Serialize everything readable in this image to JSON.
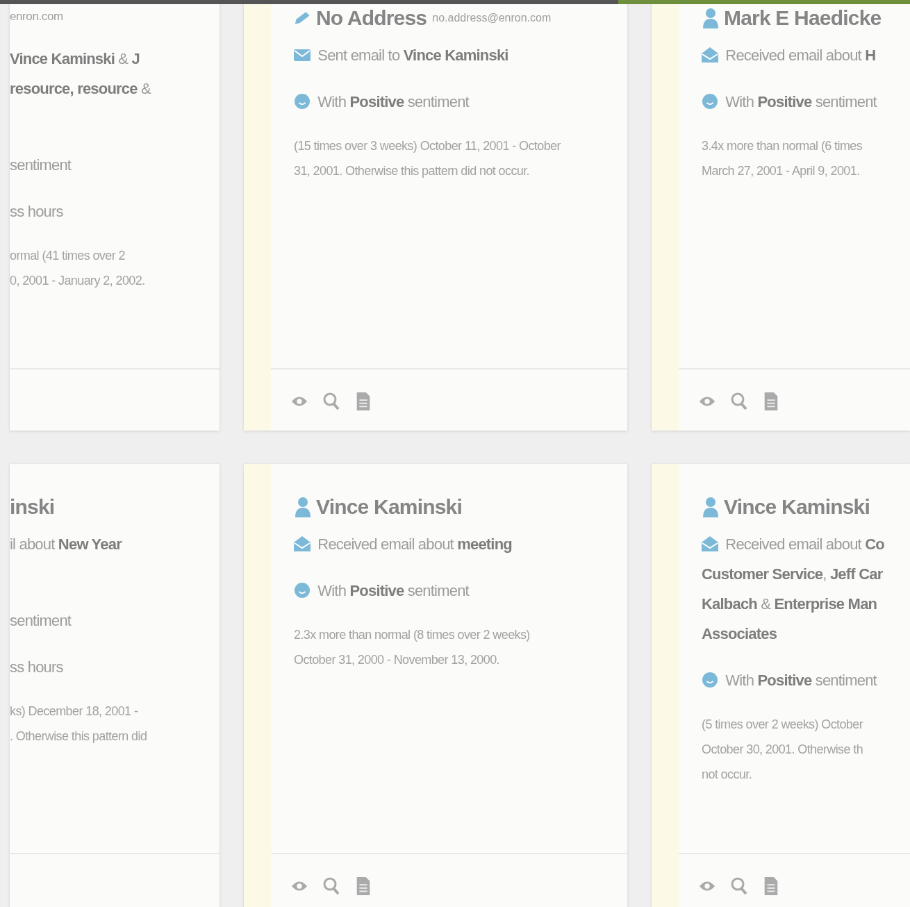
{
  "rows": [
    {
      "cards": [
        {
          "kind": "leftcut",
          "items": [
            {
              "kind": "email",
              "lines": [
                "enron.com"
              ]
            },
            {
              "kind": "received",
              "lines": [
                "**Vince Kaminski** & **J**",
                "**resource, resource** &"
              ]
            },
            {
              "kind": "sentiment",
              "lines": [
                "sentiment"
              ]
            },
            {
              "kind": "hours",
              "lines": [
                "ss hours"
              ]
            },
            {
              "kind": "detail",
              "lines": [
                "ormal (41 times over 2",
                "0, 2001 - January 2, 2002."
              ]
            }
          ]
        },
        {
          "kind": "full",
          "title": {
            "kind": "address",
            "name": "No Address",
            "email": "no.address@enron.com"
          },
          "items": [
            {
              "kind": "sent",
              "lines": [
                "Sent email to **Vince Kaminski**"
              ]
            },
            {
              "kind": "sentiment",
              "lines": [
                "With **Positive** sentiment"
              ]
            },
            {
              "kind": "detail",
              "lines": [
                "(15 times over 3 weeks) October 11, 2001 - October 31, 2001. Otherwise this pattern did not occur."
              ]
            }
          ]
        },
        {
          "kind": "rightcut",
          "title": {
            "kind": "person",
            "name": "Mark E Haedicke"
          },
          "items": [
            {
              "kind": "received",
              "lines": [
                "Received email about **H**"
              ]
            },
            {
              "kind": "sentiment",
              "lines": [
                "With **Positive** sentiment"
              ]
            },
            {
              "kind": "detail",
              "lines": [
                "3.4x more than normal (6 times",
                "March 27, 2001 - April 9, 2001."
              ]
            }
          ]
        }
      ]
    },
    {
      "cards": [
        {
          "kind": "leftcut",
          "title": {
            "name": "inski"
          },
          "items": [
            {
              "kind": "received",
              "lines": [
                "il about **New Year**"
              ]
            },
            {
              "kind": "sentiment",
              "lines": [
                "sentiment"
              ]
            },
            {
              "kind": "hours",
              "lines": [
                "ss hours"
              ]
            },
            {
              "kind": "detail",
              "lines": [
                "ks) December 18, 2001 -",
                ". Otherwise this pattern did"
              ]
            }
          ]
        },
        {
          "kind": "full",
          "title": {
            "kind": "person",
            "name": "Vince Kaminski"
          },
          "items": [
            {
              "kind": "received",
              "lines": [
                "Received email about **meeting**"
              ]
            },
            {
              "kind": "sentiment",
              "lines": [
                "With **Positive** sentiment"
              ]
            },
            {
              "kind": "detail",
              "lines": [
                "2.3x more than normal (8 times over 2 weeks) October 31, 2000 - November 13, 2000."
              ]
            }
          ]
        },
        {
          "kind": "rightcut",
          "title": {
            "kind": "person",
            "name": "Vince Kaminski"
          },
          "items": [
            {
              "kind": "received",
              "lines": [
                "Received email about **Co**",
                "**Customer Service**, **Jeff Car**",
                "**Kalbach** & **Enterprise Man**",
                "**Associates**"
              ]
            },
            {
              "kind": "sentiment",
              "lines": [
                "With **Positive** sentiment"
              ]
            },
            {
              "kind": "detail",
              "lines": [
                "(5 times over 2 weeks) October",
                "October 30, 2001. Otherwise th",
                "not occur."
              ]
            }
          ]
        }
      ]
    }
  ]
}
